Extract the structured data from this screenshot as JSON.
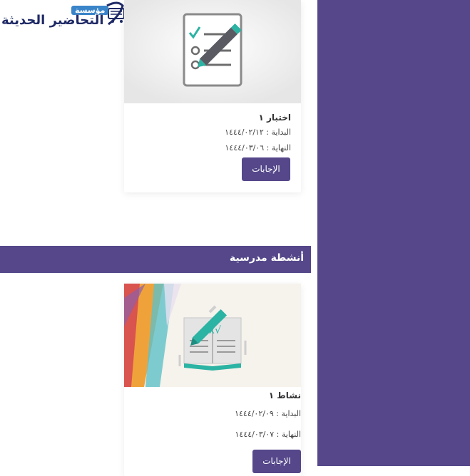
{
  "logo": {
    "name": "التحاضير الحديثة",
    "badge": "مؤسسة"
  },
  "cards": [
    {
      "title": "اختبار ١",
      "start": "البداية : ١٤٤٤/٠٢/١٢",
      "end": "النهاية : ١٤٤٤/٠٣/٠٦",
      "button": "الإجابات"
    },
    {
      "title": "نشاط ١",
      "start": "البداية : ١٤٤٤/٠٢/٠٩",
      "end": "النهاية : ١٤٤٤/٠٣/٠٧",
      "button": "الإجابات"
    }
  ],
  "section": {
    "title": "أنشطة مدرسية"
  },
  "colors": {
    "accent": "#55478a",
    "teal": "#2bb3a3"
  },
  "icons": [
    "checklist-icon",
    "book-pen-icon"
  ]
}
